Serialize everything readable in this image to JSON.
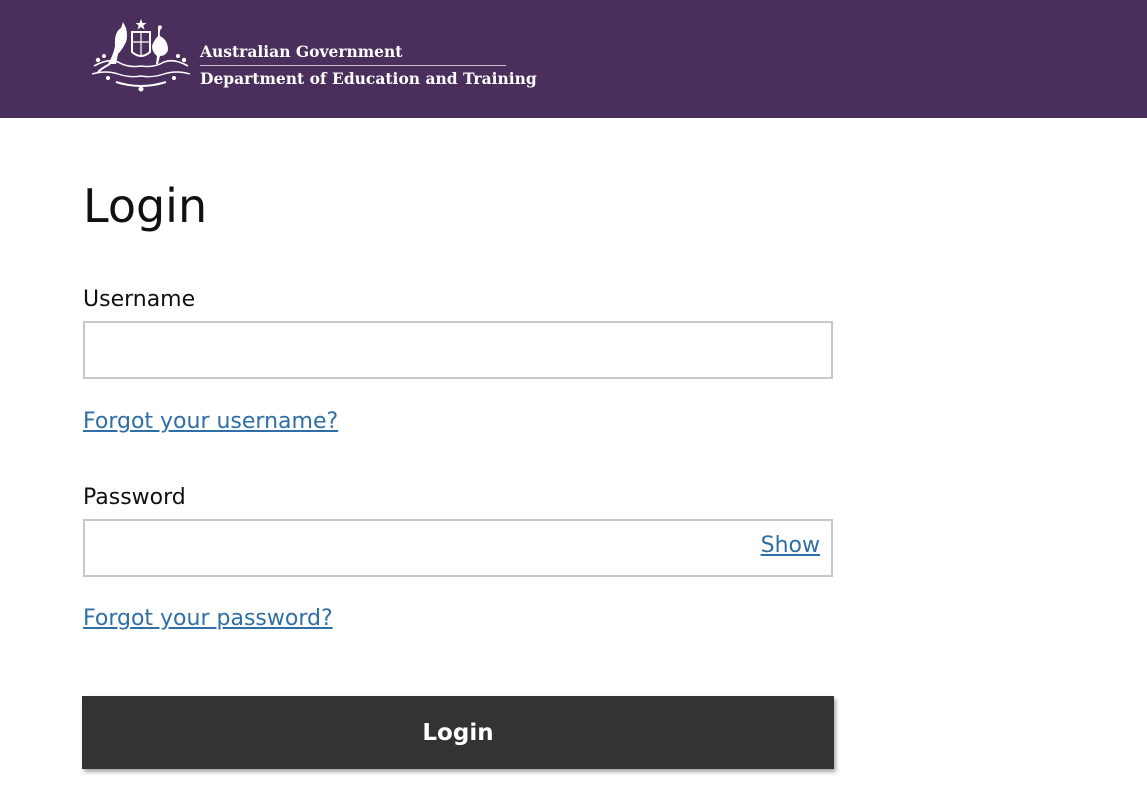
{
  "header": {
    "gov_name": "Australian Government",
    "department": "Department of Education and Training"
  },
  "main": {
    "title": "Login",
    "username": {
      "label": "Username",
      "value": "",
      "forgot_link": "Forgot your username?"
    },
    "password": {
      "label": "Password",
      "value": "",
      "show_link": "Show",
      "forgot_link": "Forgot your password?"
    },
    "login_button": "Login"
  },
  "colors": {
    "header_bg": "#4a2f5c",
    "link": "#2f6ea7",
    "button_bg": "#333333"
  },
  "icons": {
    "crest": "coat-of-arms-icon"
  }
}
